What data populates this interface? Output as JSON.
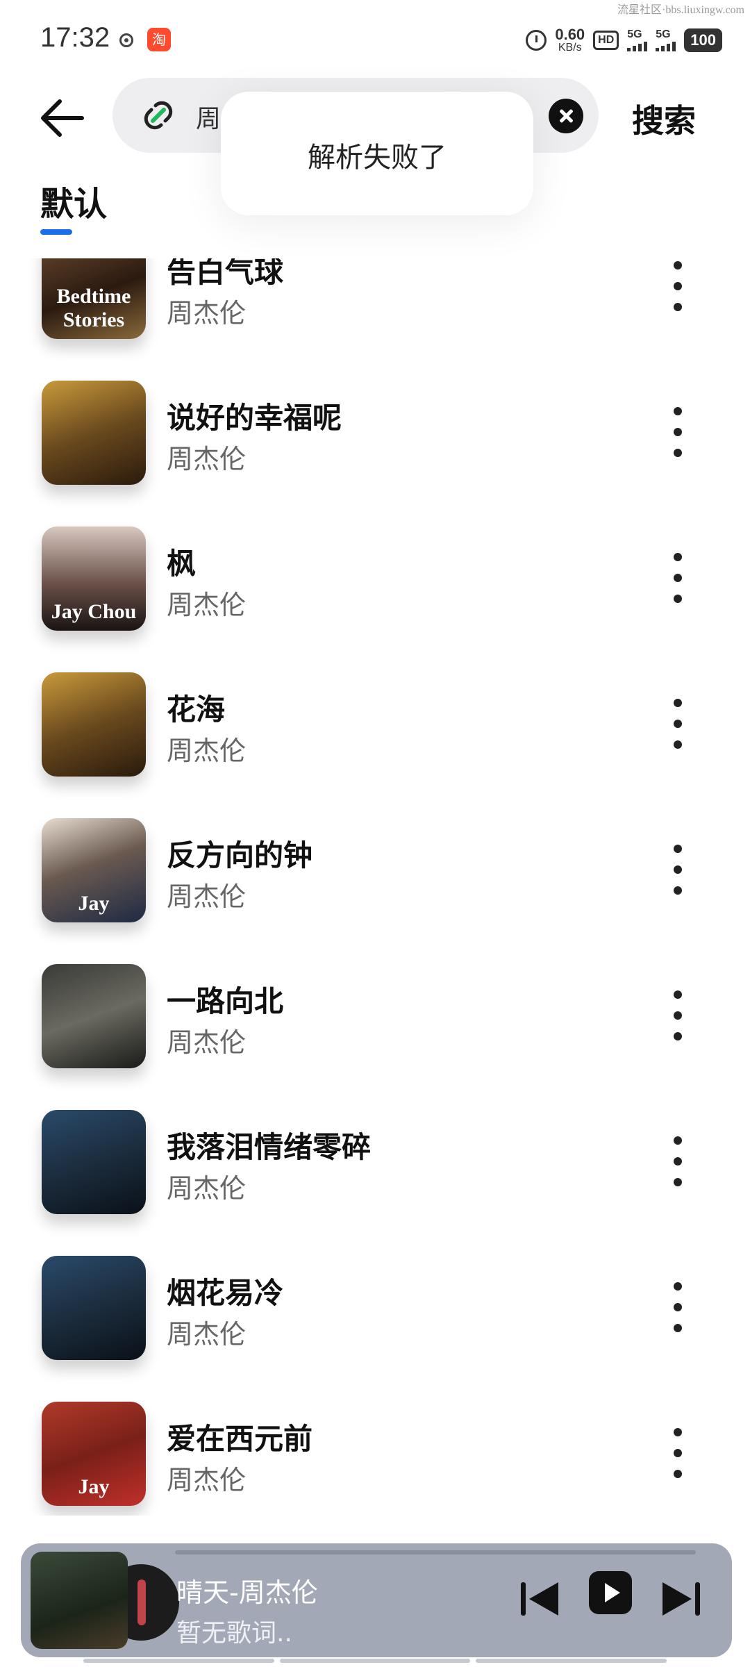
{
  "status_bar": {
    "time": "17:32",
    "app_icon_label": "淘",
    "speed_value": "0.60",
    "speed_unit": "KB/s",
    "hd_label": "HD",
    "network_1": "5G",
    "network_2": "5G",
    "battery": "100",
    "watermark": "流星社区·bbs.liuxingw.com"
  },
  "header": {
    "search_value": "周",
    "search_button": "搜索",
    "icons": [
      "back-arrow-icon",
      "link-icon",
      "clear-icon"
    ]
  },
  "tabs": [
    {
      "label": "默认",
      "active": true
    }
  ],
  "toast": {
    "message": "解析失败了"
  },
  "songs": [
    {
      "title": "告白气球",
      "artist": "周杰伦",
      "cover_text": "Bedtime Stories"
    },
    {
      "title": "说好的幸福呢",
      "artist": "周杰伦",
      "cover_text": ""
    },
    {
      "title": "枫",
      "artist": "周杰伦",
      "cover_text": "Jay Chou"
    },
    {
      "title": "花海",
      "artist": "周杰伦",
      "cover_text": ""
    },
    {
      "title": "反方向的钟",
      "artist": "周杰伦",
      "cover_text": "Jay"
    },
    {
      "title": "一路向北",
      "artist": "周杰伦",
      "cover_text": ""
    },
    {
      "title": "我落泪情绪零碎",
      "artist": "周杰伦",
      "cover_text": ""
    },
    {
      "title": "烟花易冷",
      "artist": "周杰伦",
      "cover_text": ""
    },
    {
      "title": "爱在西元前",
      "artist": "周杰伦",
      "cover_text": "Jay"
    }
  ],
  "player": {
    "now_playing": "晴天-周杰伦",
    "lyric": "暂无歌词.."
  },
  "colors": {
    "accent": "#1a6fe8",
    "link_icon": "#1fb85c",
    "player_bg": "#a3a8b6"
  }
}
